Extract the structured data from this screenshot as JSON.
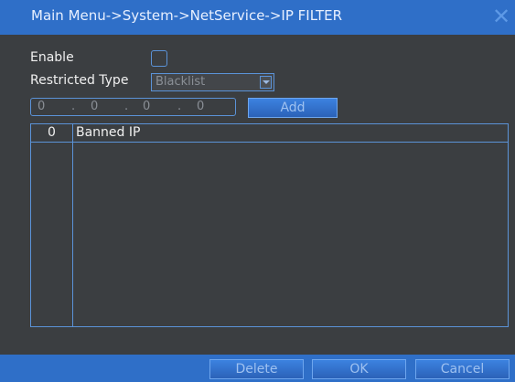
{
  "window": {
    "title": "Main Menu->System->NetService->IP FILTER"
  },
  "form": {
    "enable_label": "Enable",
    "restricted_type_label": "Restricted Type",
    "restricted_type_value": "Blacklist",
    "ip": [
      "0",
      "0",
      "0",
      "0"
    ],
    "ip_separator": ".",
    "add_label": "Add"
  },
  "table": {
    "columns": [
      "0",
      "Banned IP"
    ],
    "rows": []
  },
  "footer": {
    "delete_label": "Delete",
    "ok_label": "OK",
    "cancel_label": "Cancel"
  },
  "colors": {
    "accent": "#2f6fc8",
    "border": "#5b93d8",
    "background": "#3b3e41"
  },
  "icons": {
    "close": "close-icon"
  }
}
